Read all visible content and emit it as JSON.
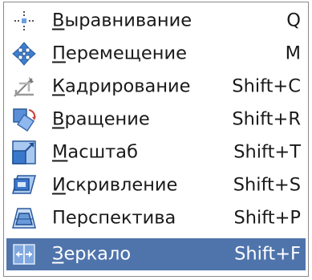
{
  "menu": {
    "items": [
      {
        "mnemonic": "В",
        "rest": "ыравнивание",
        "shortcut": "Q",
        "icon": "align-icon"
      },
      {
        "mnemonic": "П",
        "rest": "еремещение",
        "shortcut": "M",
        "icon": "move-icon"
      },
      {
        "mnemonic": "К",
        "rest": "адрирование",
        "shortcut": "Shift+C",
        "icon": "crop-icon"
      },
      {
        "mnemonic": "В",
        "rest": "ращение",
        "shortcut": "Shift+R",
        "icon": "rotate-icon"
      },
      {
        "mnemonic": "М",
        "rest": "асштаб",
        "shortcut": "Shift+T",
        "icon": "scale-icon"
      },
      {
        "mnemonic": "И",
        "rest": "скривление",
        "shortcut": "Shift+S",
        "icon": "shear-icon"
      },
      {
        "mnemonic": "",
        "rest": "Перспектива",
        "shortcut": "Shift+P",
        "icon": "perspective-icon"
      },
      {
        "mnemonic": "З",
        "rest": "еркало",
        "shortcut": "Shift+F",
        "icon": "flip-icon"
      }
    ],
    "active_index": 7,
    "colors": {
      "highlight": "#4f74ac",
      "text": "#1a1a1a",
      "highlight_text": "#ffffff"
    }
  }
}
